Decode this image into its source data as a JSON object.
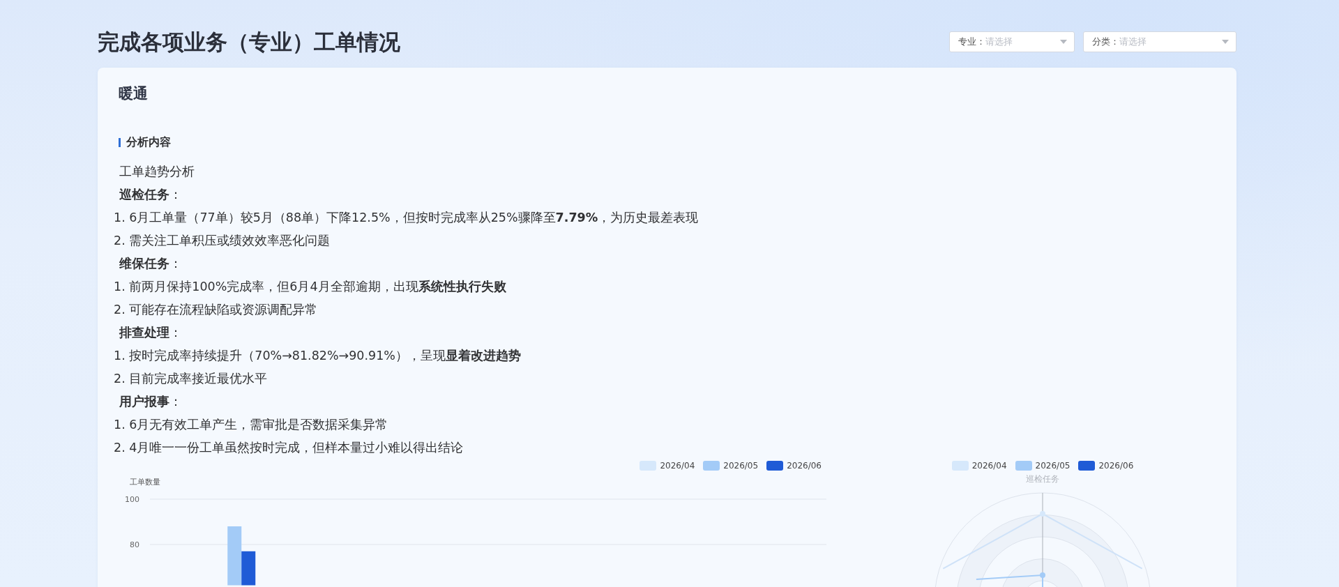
{
  "page": {
    "title": "完成各项业务（专业）工单情况"
  },
  "filters": [
    {
      "label": "专业：",
      "placeholder": "请选择"
    },
    {
      "label": "分类：",
      "placeholder": "请选择"
    }
  ],
  "card": {
    "title": "暖通",
    "section_title": "分析内容",
    "lines": [
      {
        "kind": "plain",
        "text": "工单趋势分析"
      },
      {
        "kind": "heading",
        "text": "**巡检任务**："
      },
      {
        "kind": "item",
        "text": "1. 6月工单量（77单）较5月（88单）下降12.5%，但按时完成率从25%骤降至**7.79%**，为历史最差表现"
      },
      {
        "kind": "item",
        "text": "2. 需关注工单积压或绩效效率恶化问题"
      },
      {
        "kind": "heading",
        "text": "**维保任务**："
      },
      {
        "kind": "item",
        "text": "1. 前两月保持100%完成率，但6月4月全部逾期，出现**系统性执行失败**"
      },
      {
        "kind": "item",
        "text": "2. 可能存在流程缺陷或资源调配异常"
      },
      {
        "kind": "heading",
        "text": "**排查处理**："
      },
      {
        "kind": "item",
        "text": "1. 按时完成率持续提升（70%→81.82%→90.91%），呈现**显着改进趋势**"
      },
      {
        "kind": "item",
        "text": "2. 目前完成率接近最优水平"
      },
      {
        "kind": "heading",
        "text": "**用户报事**："
      },
      {
        "kind": "item",
        "text": "1. 6月无有效工单产生，需审批是否数据采集异常"
      },
      {
        "kind": "item",
        "text": "2. 4月唯一一份工单虽然按时完成，但样本量过小难以得出结论"
      }
    ],
    "bar_chart": {
      "chart_data": {
        "type": "bar",
        "ylabel": "工单数量",
        "ylim": [
          62,
          100
        ],
        "yticks": [
          80,
          100
        ],
        "series": [
          {
            "name": "2026/04",
            "color": "#d6e8fb",
            "values": [
              null
            ]
          },
          {
            "name": "2026/05",
            "color": "#a3cbf7",
            "values": [
              88
            ]
          },
          {
            "name": "2026/06",
            "color": "#1f5bd6",
            "values": [
              77
            ]
          }
        ]
      }
    },
    "radar_chart": {
      "legend": [
        {
          "label": "2026/04",
          "color": "#d6e8fb"
        },
        {
          "label": "2026/05",
          "color": "#a3cbf7"
        },
        {
          "label": "2026/06",
          "color": "#1f5bd6"
        }
      ],
      "axis_label": "巡检任务"
    }
  }
}
